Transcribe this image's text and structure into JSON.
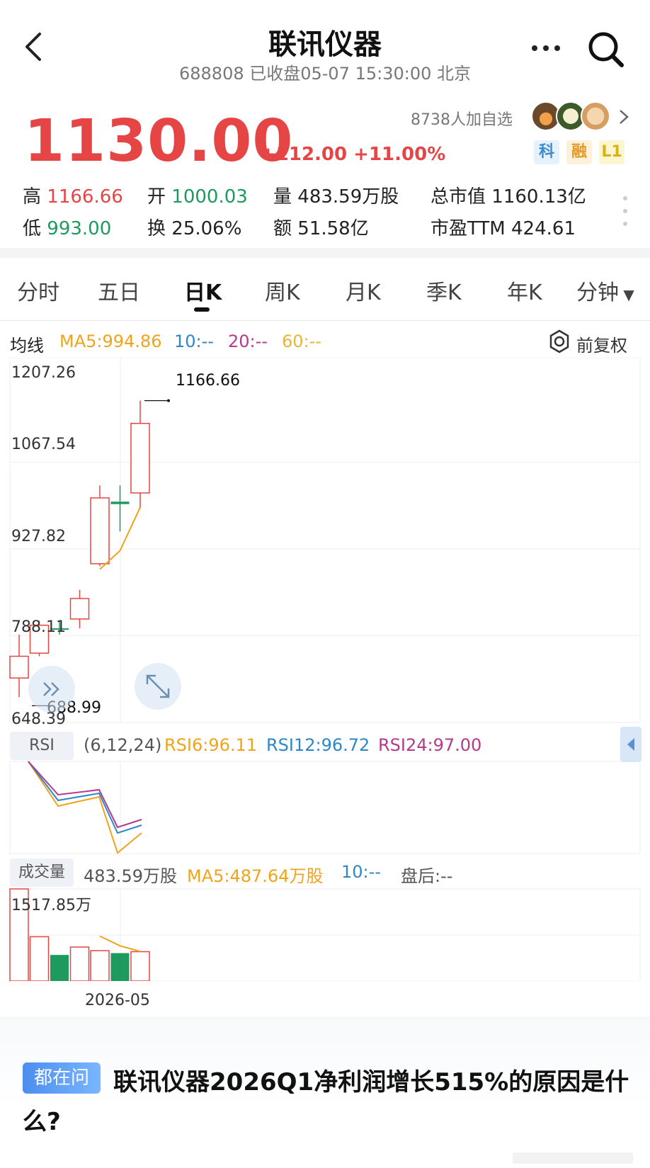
{
  "header": {
    "title": "联讯仪器",
    "subtitle": "688808 已收盘05-07 15:30:00 北京"
  },
  "quote": {
    "price": "1130.00",
    "change": "+112.00 +11.00%",
    "followers": "8738人加自选",
    "badges": [
      "科",
      "融",
      "L1"
    ],
    "stats": {
      "high_label": "高",
      "high_value": "1166.66",
      "open_label": "开",
      "open_value": "1000.03",
      "volume_label": "量",
      "volume_value": "483.59万股",
      "mcap_label": "总市值",
      "mcap_value": "1160.13亿",
      "low_label": "低",
      "low_value": "993.00",
      "turnover_label": "换",
      "turnover_value": "25.06%",
      "amount_label": "额",
      "amount_value": "51.58亿",
      "pe_label": "市盈TTM",
      "pe_value": "424.61"
    }
  },
  "tabs": [
    "分时",
    "五日",
    "日K",
    "周K",
    "月K",
    "季K",
    "年K",
    "分钟"
  ],
  "active_tab": "日K",
  "ma": {
    "label": "均线",
    "ma5": "MA5:994.86",
    "ma10": "10:--",
    "ma20": "20:--",
    "ma60": "60:--",
    "adjust": "前复权"
  },
  "rsi": {
    "label": "RSI",
    "params": "(6,12,24)",
    "rsi6": "RSI6:96.11",
    "rsi12": "RSI12:96.72",
    "rsi24": "RSI24:97.00"
  },
  "volume": {
    "label": "成交量",
    "value": "483.59万股",
    "ma5": "MA5:487.64万股",
    "ma10": "10:--",
    "after_hours": "盘后:--",
    "max_label": "1517.85万"
  },
  "date_axis": "2026-05",
  "ask": {
    "tag": "都在问",
    "question": "联讯仪器2026Q1净利润增长515%的原因是什么?"
  },
  "colors": {
    "up": "#e54545",
    "down": "#1e9a5e",
    "ma5": "#f0a31b",
    "ma10": "#2f86c9",
    "ma20": "#b43a8c",
    "ma60": "#e8b530"
  },
  "chart_data": {
    "type": "candlestick",
    "y_ticks": [
      "1207.26",
      "1067.54",
      "927.82",
      "788.11",
      "648.39"
    ],
    "ylim": [
      648.39,
      1207.26
    ],
    "high_marker": "1166.66",
    "low_marker": "688.99",
    "candles": [
      {
        "open": 755,
        "close": 720,
        "high": 790,
        "low": 688.99,
        "dir": "up"
      },
      {
        "open": 805,
        "close": 760,
        "high": 812,
        "low": 755,
        "dir": "up"
      },
      {
        "open": 800,
        "close": 800,
        "high": 812,
        "low": 790,
        "dir": "down"
      },
      {
        "open": 848,
        "close": 815,
        "high": 862,
        "low": 800,
        "dir": "up"
      },
      {
        "open": 1010,
        "close": 904,
        "high": 1030,
        "low": 900,
        "dir": "up"
      },
      {
        "open": 1004,
        "close": 1000,
        "high": 1030,
        "low": 956,
        "dir": "down"
      },
      {
        "open": 1130,
        "close": 1018,
        "high": 1166.66,
        "low": 993,
        "dir": "up"
      }
    ],
    "ma5": [
      null,
      null,
      null,
      null,
      895,
      925,
      994.86
    ],
    "volume": [
      1517.85,
      730,
      430,
      560,
      500,
      460,
      483.59
    ],
    "volume_ma5": [
      null,
      null,
      null,
      null,
      740,
      580,
      487.64
    ]
  }
}
